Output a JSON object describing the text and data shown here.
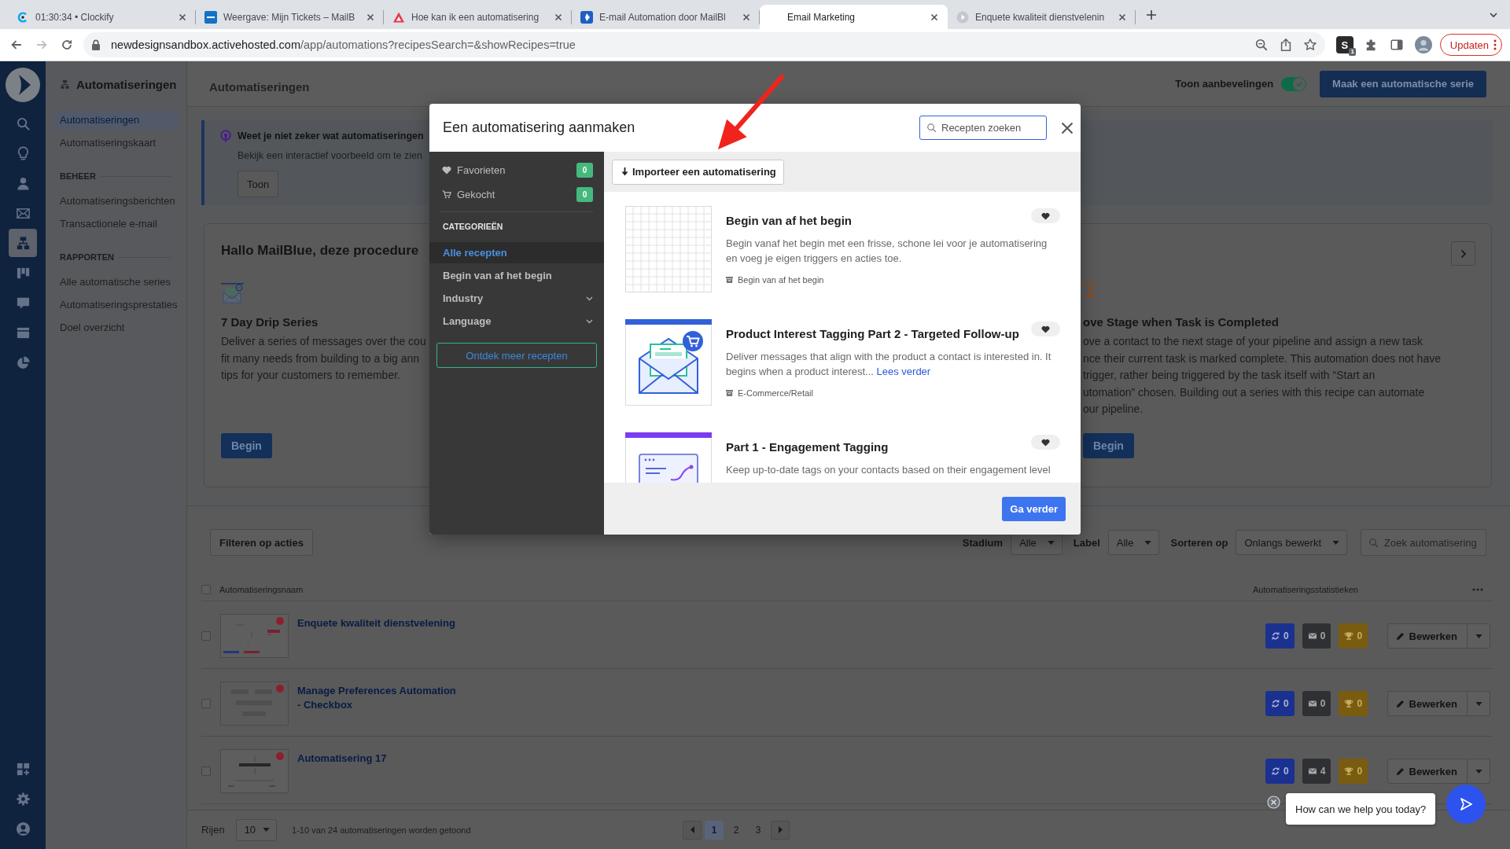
{
  "browser": {
    "tabs": [
      {
        "kind": "clockify",
        "title": "01:30:34 • Clockify",
        "selected": false
      },
      {
        "kind": "square",
        "title": "Weergave: Mijn Tickets – MailB",
        "selected": false
      },
      {
        "kind": "triangle",
        "title": "Hoe kan ik een automatisering",
        "selected": false
      },
      {
        "kind": "badge",
        "title": "E-mail Automation door MailBl",
        "selected": false
      },
      {
        "kind": "none",
        "title": "Email Marketing",
        "selected": true
      },
      {
        "kind": "globe",
        "title": "Enquete kwaliteit dienstvelenin",
        "selected": false
      }
    ],
    "nav_buttons": [
      {
        "kind": "back",
        "disabled": false
      },
      {
        "kind": "forward",
        "disabled": true
      },
      {
        "kind": "reload",
        "disabled": false
      }
    ],
    "url": {
      "host": "newdesignsandbox.activehosted.com",
      "path": "/app/automations?recipesSearch=&showRecipes=true"
    },
    "extension": {
      "label": "S",
      "badge": "1"
    },
    "update_button": "Updaten"
  },
  "nav_rail": {
    "items": [
      {
        "kind": "search",
        "selected": false
      },
      {
        "kind": "ideas",
        "selected": false
      },
      {
        "kind": "contacts",
        "selected": false
      },
      {
        "kind": "campaigns",
        "selected": false
      },
      {
        "kind": "automations",
        "selected": true
      },
      {
        "kind": "deals",
        "selected": false
      },
      {
        "kind": "conversations",
        "selected": false
      },
      {
        "kind": "pages",
        "selected": false
      },
      {
        "kind": "reports",
        "selected": false
      }
    ],
    "bottom_items": [
      {
        "kind": "apps",
        "selected": false
      },
      {
        "kind": "settings",
        "selected": false
      },
      {
        "kind": "account",
        "selected": false
      }
    ]
  },
  "side_nav": {
    "title": "Automatiseringen",
    "items": [
      {
        "label": "Automatiseringen",
        "selected": true
      },
      {
        "label": "Automatiseringskaart",
        "selected": false
      }
    ],
    "groups": [
      {
        "heading": "BEHEER",
        "items": [
          {
            "label": "Automatiseringsberichten",
            "selected": false
          },
          {
            "label": "Transactionele e-mail",
            "selected": false
          }
        ]
      },
      {
        "heading": "RAPPORTEN",
        "items": [
          {
            "label": "Alle automatische series",
            "selected": false
          },
          {
            "label": "Automatiseringsprestaties",
            "selected": false
          },
          {
            "label": "Doel overzicht",
            "selected": false
          }
        ]
      }
    ]
  },
  "page_header": {
    "title": "Automatiseringen",
    "toggle": {
      "label": "Toon aanbevelingen",
      "on": true
    },
    "create_button": "Maak een automatische serie"
  },
  "info_banner": {
    "title": "Weet je niet zeker wat automatiseringen",
    "text": "Bekijk een interactief voorbeeld om te zien",
    "button": "Toon"
  },
  "recommendations": {
    "title": "Hallo MailBlue, deze procedure",
    "recipes": [
      {
        "kind": "drip",
        "title": "7 Day Drip Series",
        "lines": [
          "Deliver a series of messages over the cou",
          "fit many needs from building to a big ann",
          "tips for your customers to remember."
        ],
        "button": "Begin"
      },
      {
        "kind": "pipeline",
        "title": "ove Stage when Task is Completed",
        "lines": [
          "ove a contact to the next stage of your pipeline and assign a new task",
          "nce their current task is marked complete. This automation does not have",
          "trigger, rather being triggered by the task itself with “Start an",
          "utomation” chosen. Building out a series with this recipe can automate",
          "our pipeline."
        ],
        "button": "Begin"
      }
    ]
  },
  "filters": {
    "button": "Filteren op acties",
    "selects": [
      {
        "label": "Stadium",
        "value": "Alle"
      },
      {
        "label": "Label",
        "value": "Alle"
      },
      {
        "label": "Sorteren op",
        "value": "Onlangs bewerkt"
      }
    ],
    "search": {
      "placeholder": "Zoek automatisering"
    }
  },
  "table": {
    "select_all": {
      "checked": false
    },
    "columns": [
      "Automatiseringsnaam",
      "Automatiseringsstatistieken"
    ],
    "rows": [
      {
        "kind": "flow",
        "name": "Enquete kwaliteit dienstvelening",
        "checked": false,
        "stats": [
          {
            "kind": "contacts",
            "value": "0"
          },
          {
            "kind": "emails",
            "value": "0"
          },
          {
            "kind": "goals",
            "value": "0"
          }
        ],
        "edit_button": "Bewerken"
      },
      {
        "kind": "blocks",
        "name": "Manage Preferences Automation - Checkbox",
        "checked": false,
        "stats": [
          {
            "kind": "contacts",
            "value": "0"
          },
          {
            "kind": "emails",
            "value": "0"
          },
          {
            "kind": "goals",
            "value": "0"
          }
        ],
        "edit_button": "Bewerken"
      },
      {
        "kind": "banner",
        "name": "Automatisering 17",
        "checked": false,
        "stats": [
          {
            "kind": "contacts",
            "value": "0"
          },
          {
            "kind": "emails",
            "value": "4"
          },
          {
            "kind": "goals",
            "value": "0"
          }
        ],
        "edit_button": "Bewerken"
      }
    ]
  },
  "pagination": {
    "rows_label": "Rijen",
    "rows_value": "10",
    "summary": "1-10 van 24 automatiseringen worden getoond",
    "pages": [
      {
        "label": "1",
        "selected": true
      },
      {
        "label": "2",
        "selected": false
      },
      {
        "label": "3",
        "selected": false
      }
    ]
  },
  "modal": {
    "title": "Een automatisering aanmaken",
    "search": {
      "placeholder": "Recepten zoeken"
    },
    "quick_links": [
      {
        "kind": "favorites",
        "label": "Favorieten",
        "count": "0"
      },
      {
        "kind": "purchased",
        "label": "Gekocht",
        "count": "0"
      }
    ],
    "categories_heading": "CATEGORIEËN",
    "categories": [
      {
        "kind": "link",
        "label": "Alle recepten",
        "selected": true
      },
      {
        "kind": "link",
        "label": "Begin van af het begin",
        "selected": false
      },
      {
        "kind": "group",
        "label": "Industry",
        "selected": false
      },
      {
        "kind": "group",
        "label": "Language",
        "selected": false
      }
    ],
    "discover_button": "Ontdek meer recepten",
    "import_button": "Importeer een automatisering",
    "recipes": [
      {
        "kind": "blank",
        "title": "Begin van af het begin",
        "description": "Begin vanaf het begin met een frisse, schone lei voor je automatisering en voeg je eigen triggers en acties toe.",
        "tag": "Begin van af het begin"
      },
      {
        "kind": "ecommerce",
        "title": "Product Interest Tagging Part 2 - Targeted Follow-up",
        "description": "Deliver messages that align with the product a contact is interested in. It begins when a product interest...",
        "link": "Lees verder",
        "tag": "E-Commerce/Retail"
      },
      {
        "kind": "engagement",
        "title": "Part 1 - Engagement Tagging",
        "description": "Keep up-to-date tags on your contacts based on their engagement level"
      }
    ],
    "continue_button": "Ga verder"
  },
  "chat_widget": {
    "message": "How can we help you today?"
  }
}
